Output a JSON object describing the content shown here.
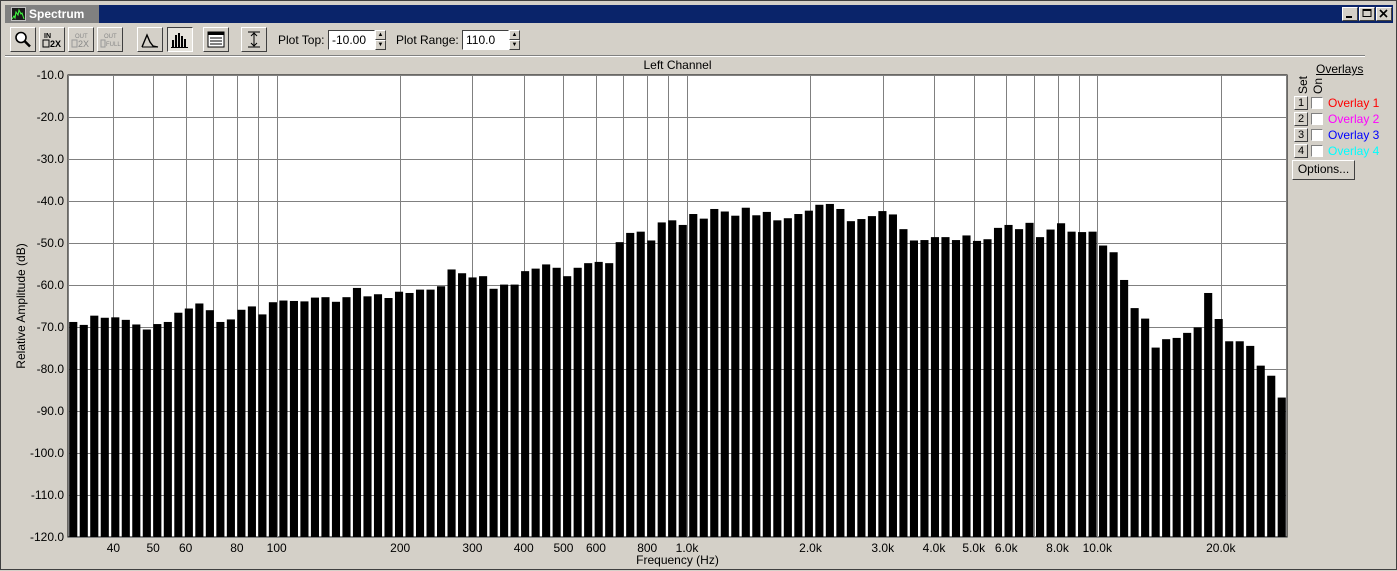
{
  "window": {
    "title": "Spectrum"
  },
  "toolbar": {
    "buttons": [
      {
        "icon": "zoom-magnifier-icon"
      },
      {
        "icon": "zoom-in-2x-icon",
        "text": "IN 2X"
      },
      {
        "icon": "zoom-out-2x-icon",
        "text": "OUT 2X"
      },
      {
        "icon": "zoom-out-full-icon",
        "text": "OUT FULL"
      },
      {
        "icon": "line-graph-icon"
      },
      {
        "icon": "bar-graph-icon"
      },
      {
        "icon": "properties-icon"
      },
      {
        "icon": "autoscale-icon"
      }
    ],
    "plot_top_label": "Plot Top:",
    "plot_top_value": "-10.00",
    "plot_range_label": "Plot Range:",
    "plot_range_value": "110.0"
  },
  "overlays": {
    "title": "Overlays",
    "set_label": "Set",
    "on_label": "On",
    "items": [
      {
        "num": "1",
        "name": "Overlay 1",
        "color": "#ff0000",
        "checked": false
      },
      {
        "num": "2",
        "name": "Overlay 2",
        "color": "#ff00ff",
        "checked": false
      },
      {
        "num": "3",
        "name": "Overlay 3",
        "color": "#0000ff",
        "checked": false
      },
      {
        "num": "4",
        "name": "Overlay 4",
        "color": "#00ffff",
        "checked": false
      }
    ],
    "options_label": "Options..."
  },
  "chart_data": {
    "type": "bar",
    "title": "Left Channel",
    "xlabel": "Frequency (Hz)",
    "ylabel": "Relative Amplitude (dB)",
    "x_scale": "log",
    "xlim": [
      31,
      29000
    ],
    "ylim": [
      -120,
      -10
    ],
    "grid": true,
    "bar_color": "#000000",
    "yticks": [
      -10,
      -20,
      -30,
      -40,
      -50,
      -60,
      -70,
      -80,
      -90,
      -100,
      -110,
      -120
    ],
    "ytick_labels": [
      "-10.0",
      "-20.0",
      "-30.0",
      "-40.0",
      "-50.0",
      "-60.0",
      "-70.0",
      "-80.0",
      "-90.0",
      "-100.0",
      "-110.0",
      "-120.0"
    ],
    "xticks": [
      {
        "value": 40,
        "label": "40"
      },
      {
        "value": 50,
        "label": "50"
      },
      {
        "value": 60,
        "label": "60"
      },
      {
        "value": 80,
        "label": "80"
      },
      {
        "value": 100,
        "label": "100"
      },
      {
        "value": 200,
        "label": "200"
      },
      {
        "value": 300,
        "label": "300"
      },
      {
        "value": 400,
        "label": "400"
      },
      {
        "value": 500,
        "label": "500"
      },
      {
        "value": 600,
        "label": "600"
      },
      {
        "value": 800,
        "label": "800"
      },
      {
        "value": 1000,
        "label": "1.0k"
      },
      {
        "value": 2000,
        "label": "2.0k"
      },
      {
        "value": 3000,
        "label": "3.0k"
      },
      {
        "value": 4000,
        "label": "4.0k"
      },
      {
        "value": 5000,
        "label": "5.0k"
      },
      {
        "value": 6000,
        "label": "6.0k"
      },
      {
        "value": 8000,
        "label": "8.0k"
      },
      {
        "value": 10000,
        "label": "10.0k"
      },
      {
        "value": 20000,
        "label": "20.0k"
      }
    ],
    "gridlines_x": [
      40,
      50,
      60,
      70,
      80,
      90,
      100,
      200,
      300,
      400,
      500,
      600,
      700,
      800,
      900,
      1000,
      2000,
      3000,
      4000,
      5000,
      6000,
      7000,
      8000,
      9000,
      10000,
      20000
    ],
    "values": [
      -68.8,
      -69.5,
      -67.3,
      -67.8,
      -67.7,
      -68.3,
      -69.4,
      -70.6,
      -69.3,
      -68.8,
      -66.6,
      -65.6,
      -64.4,
      -66.0,
      -68.8,
      -68.2,
      -65.9,
      -65.1,
      -67.0,
      -64.1,
      -63.7,
      -63.8,
      -63.9,
      -63.0,
      -62.9,
      -64.0,
      -62.9,
      -60.7,
      -62.7,
      -62.2,
      -63.1,
      -61.6,
      -61.9,
      -61.1,
      -61.1,
      -60.3,
      -56.3,
      -57.2,
      -58.2,
      -57.9,
      -60.9,
      -59.9,
      -59.9,
      -56.7,
      -56.1,
      -55.1,
      -55.9,
      -57.9,
      -55.9,
      -54.8,
      -54.5,
      -54.8,
      -49.8,
      -47.6,
      -47.3,
      -49.4,
      -45.1,
      -44.6,
      -45.7,
      -43.1,
      -44.2,
      -41.9,
      -42.5,
      -43.5,
      -41.6,
      -43.4,
      -42.6,
      -44.6,
      -44.1,
      -43.1,
      -42.3,
      -40.9,
      -40.7,
      -41.9,
      -44.8,
      -44.3,
      -43.6,
      -42.4,
      -43.2,
      -46.7,
      -49.4,
      -49.3,
      -48.6,
      -48.6,
      -49.3,
      -48.2,
      -49.5,
      -49.1,
      -46.4,
      -45.7,
      -46.7,
      -45.2,
      -48.6,
      -46.8,
      -45.3,
      -47.3,
      -47.4,
      -47.3,
      -50.6,
      -52.2,
      -58.8,
      -65.5,
      -68.0,
      -74.9,
      -72.9,
      -72.6,
      -71.4,
      -70.1,
      -61.9,
      -68.1,
      -73.4,
      -73.4,
      -74.5,
      -79.2,
      -81.6,
      -86.8
    ]
  }
}
